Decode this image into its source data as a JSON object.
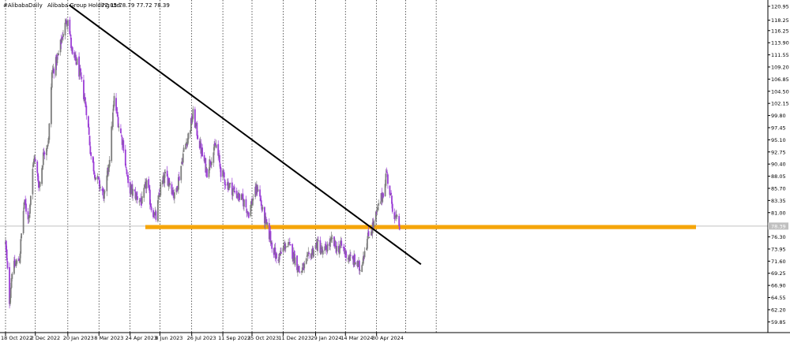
{
  "window": {
    "symbol": "#Alibaba",
    "timeframe": "Daily",
    "description": "Alibaba Group Holding Ltd.",
    "ohlc": "77.05 78.79 77.72 78.39"
  },
  "colors": {
    "background": "#ffffff",
    "bull_candle": "#7d7d7d",
    "bear_candle": "#9b3ed6",
    "trendline": "#000000",
    "support_zone": "#f5a50a",
    "grid": "#1a1a1a",
    "price_line": "#c0c0c0",
    "price_label_bg": "#c0c0c0"
  },
  "chart_data": {
    "type": "candlestick",
    "title": "#Alibaba, Daily:  Alibaba Group Holding Ltd.",
    "ylim": [
      60.9,
      122.0
    ],
    "y_ticks": [
      "120.95",
      "118.25",
      "116.25",
      "113.90",
      "111.55",
      "109.20",
      "106.85",
      "104.50",
      "102.15",
      "99.80",
      "97.45",
      "95.10",
      "92.75",
      "90.40",
      "88.05",
      "85.70",
      "83.35",
      "81.00",
      "78.65",
      "76.30",
      "73.95",
      "71.60",
      "69.25",
      "66.90",
      "64.55",
      "62.20",
      "59.85"
    ],
    "x_ticks": [
      "18 Oct 2022",
      "2 Dec 2022",
      "20 Jan 2023",
      "8 Mar 2023",
      "24 Apr 2023",
      "8 Jun 2023",
      "26 Jul 2023",
      "11 Sep 2023",
      "25 Oct 2023",
      "11 Dec 2023",
      "29 Jan 2024",
      "14 Mar 2024",
      "30 Apr 2024"
    ],
    "current_price": 78.39,
    "current_price_label": "78.39",
    "grid": "vertical dotted at each date tick",
    "support_zone": {
      "from": 77.8,
      "to": 78.6,
      "start_date": "2023-05-17"
    },
    "trendline": {
      "start": [
        "2023-01-22",
        121.2
      ],
      "end": [
        "2024-07-06",
        71.0
      ]
    },
    "anchors": [
      [
        "2022-10-18",
        75.0
      ],
      [
        "2022-10-24",
        64.0
      ],
      [
        "2022-10-28",
        70.0
      ],
      [
        "2022-11-08",
        72.0
      ],
      [
        "2022-11-15",
        83.0
      ],
      [
        "2022-11-22",
        80.0
      ],
      [
        "2022-11-30",
        92.0
      ],
      [
        "2022-12-08",
        86.0
      ],
      [
        "2022-12-15",
        93.0
      ],
      [
        "2022-12-22",
        95.0
      ],
      [
        "2022-12-27",
        108.0
      ],
      [
        "2023-01-05",
        111.0
      ],
      [
        "2023-01-13",
        116.0
      ],
      [
        "2023-01-20",
        119.0
      ],
      [
        "2023-01-27",
        111.0
      ],
      [
        "2023-02-03",
        110.0
      ],
      [
        "2023-02-10",
        106.0
      ],
      [
        "2023-02-17",
        101.0
      ],
      [
        "2023-02-24",
        92.0
      ],
      [
        "2023-03-03",
        88.0
      ],
      [
        "2023-03-10",
        86.0
      ],
      [
        "2023-03-17",
        84.0
      ],
      [
        "2023-03-24",
        92.0
      ],
      [
        "2023-03-31",
        103.0
      ],
      [
        "2023-04-07",
        98.0
      ],
      [
        "2023-04-14",
        94.0
      ],
      [
        "2023-04-21",
        86.0
      ],
      [
        "2023-04-28",
        85.0
      ],
      [
        "2023-05-05",
        84.0
      ],
      [
        "2023-05-12",
        83.0
      ],
      [
        "2023-05-19",
        87.0
      ],
      [
        "2023-05-26",
        82.0
      ],
      [
        "2023-06-02",
        80.0
      ],
      [
        "2023-06-09",
        86.0
      ],
      [
        "2023-06-16",
        88.0
      ],
      [
        "2023-06-23",
        87.0
      ],
      [
        "2023-06-30",
        84.0
      ],
      [
        "2023-07-07",
        88.0
      ],
      [
        "2023-07-14",
        93.0
      ],
      [
        "2023-07-21",
        96.0
      ],
      [
        "2023-07-28",
        100.0
      ],
      [
        "2023-08-04",
        96.0
      ],
      [
        "2023-08-11",
        92.0
      ],
      [
        "2023-08-18",
        89.0
      ],
      [
        "2023-08-25",
        92.0
      ],
      [
        "2023-09-01",
        94.0
      ],
      [
        "2023-09-08",
        89.0
      ],
      [
        "2023-09-15",
        87.0
      ],
      [
        "2023-09-22",
        86.0
      ],
      [
        "2023-09-29",
        85.0
      ],
      [
        "2023-10-06",
        84.0
      ],
      [
        "2023-10-13",
        83.0
      ],
      [
        "2023-10-20",
        81.0
      ],
      [
        "2023-10-27",
        84.0
      ],
      [
        "2023-11-03",
        86.0
      ],
      [
        "2023-11-10",
        81.0
      ],
      [
        "2023-11-17",
        78.0
      ],
      [
        "2023-11-24",
        75.0
      ],
      [
        "2023-12-01",
        72.0
      ],
      [
        "2023-12-08",
        73.0
      ],
      [
        "2023-12-15",
        75.0
      ],
      [
        "2023-12-22",
        74.0
      ],
      [
        "2023-12-29",
        72.0
      ],
      [
        "2024-01-05",
        69.5
      ],
      [
        "2024-01-12",
        70.5
      ],
      [
        "2024-01-19",
        72.5
      ],
      [
        "2024-01-26",
        74.0
      ],
      [
        "2024-02-02",
        75.0
      ],
      [
        "2024-02-09",
        73.0
      ],
      [
        "2024-02-16",
        74.5
      ],
      [
        "2024-02-23",
        75.5
      ],
      [
        "2024-03-01",
        74.0
      ],
      [
        "2024-03-08",
        74.5
      ],
      [
        "2024-03-15",
        73.0
      ],
      [
        "2024-03-22",
        72.0
      ],
      [
        "2024-03-29",
        71.5
      ],
      [
        "2024-04-05",
        70.0
      ],
      [
        "2024-04-12",
        74.0
      ],
      [
        "2024-04-19",
        77.0
      ],
      [
        "2024-04-26",
        79.0
      ],
      [
        "2024-05-03",
        82.0
      ],
      [
        "2024-05-10",
        85.0
      ],
      [
        "2024-05-15",
        89.0
      ],
      [
        "2024-05-21",
        84.0
      ],
      [
        "2024-05-28",
        80.0
      ],
      [
        "2024-06-04",
        78.4
      ]
    ]
  }
}
